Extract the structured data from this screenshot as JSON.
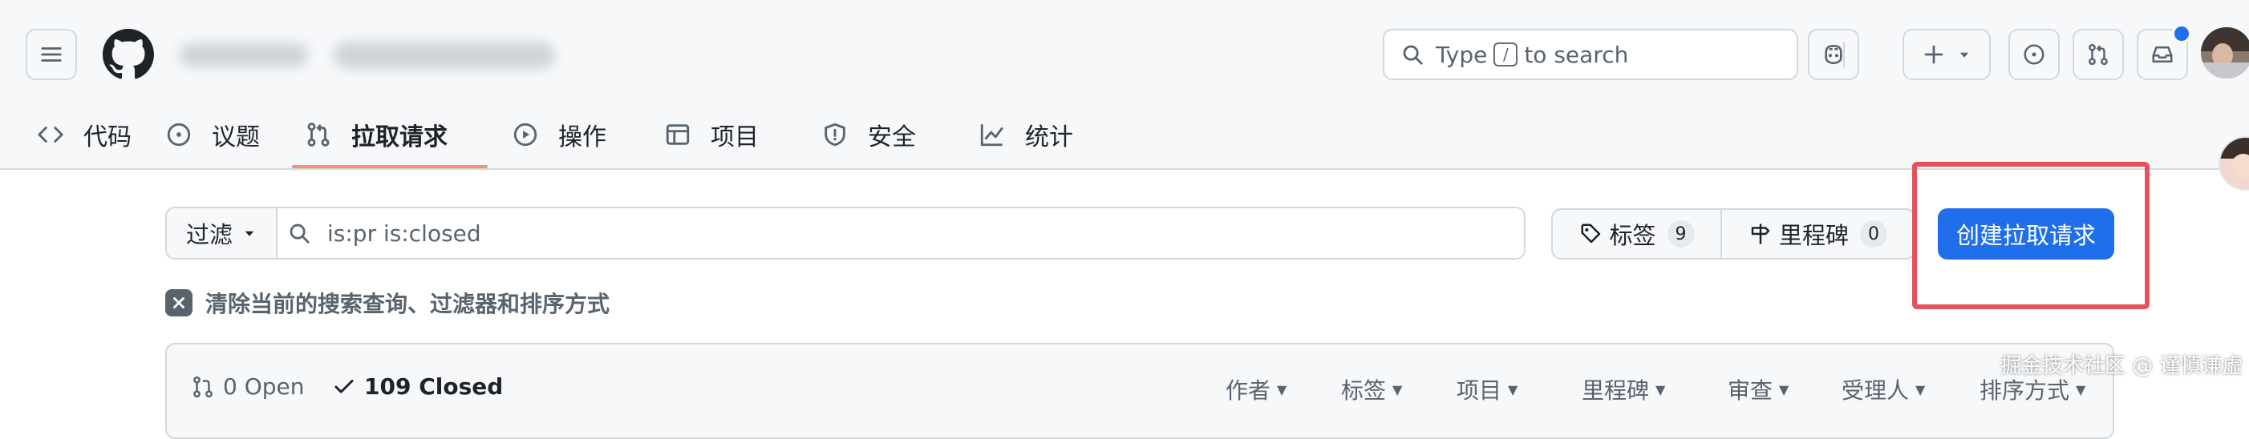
{
  "header": {
    "search_prefix": "Type",
    "search_kbd": "/",
    "search_suffix": "to search",
    "notification_dot_color": "#1f6feb"
  },
  "tabs": [
    {
      "label": "代码",
      "icon": "code-icon"
    },
    {
      "label": "议题",
      "icon": "issue-opened-icon"
    },
    {
      "label": "拉取请求",
      "icon": "git-pull-request-icon",
      "selected": true
    },
    {
      "label": "操作",
      "icon": "play-icon"
    },
    {
      "label": "项目",
      "icon": "table-icon"
    },
    {
      "label": "安全",
      "icon": "shield-icon"
    },
    {
      "label": "统计",
      "icon": "graph-icon"
    }
  ],
  "filter": {
    "button_label": "过滤",
    "query": "is:pr is:closed"
  },
  "labels": {
    "label": "标签",
    "count": "9"
  },
  "milestones": {
    "label": "里程碑",
    "count": "0"
  },
  "new_pr": {
    "label": "创建拉取请求",
    "color": "#1f6feb"
  },
  "clear_filters": "清除当前的搜索查询、过滤器和排序方式",
  "list_header": {
    "open": "0 Open",
    "closed": "109 Closed",
    "sort_options": [
      "作者",
      "标签",
      "项目",
      "里程碑",
      "审查",
      "受理人",
      "排序方式"
    ]
  },
  "watermark": "掘金技术社区 @ 谨慎谦虚",
  "colors": {
    "accent": "#1f6feb",
    "underline": "#fd8c73",
    "highlight_box": "#e8505b"
  }
}
